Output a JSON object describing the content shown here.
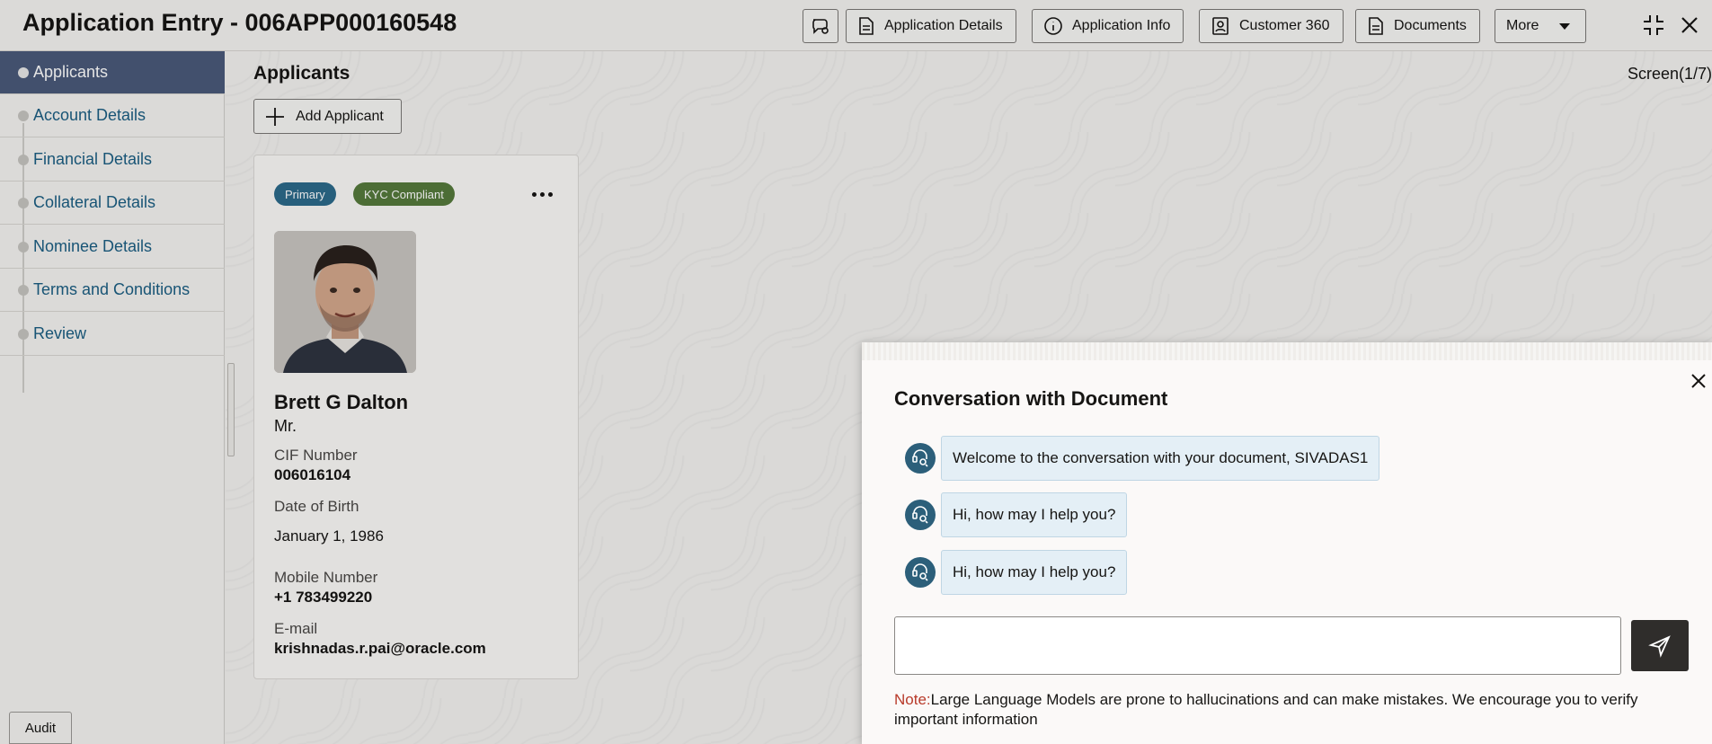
{
  "header": {
    "title": "Application Entry - 006APP000160548",
    "buttons": [
      {
        "label": "Application Details",
        "icon": "document-icon"
      },
      {
        "label": "Application Info",
        "icon": "info-icon"
      },
      {
        "label": "Customer 360",
        "icon": "customer-icon"
      },
      {
        "label": "Documents",
        "icon": "document-icon"
      },
      {
        "label": "More",
        "icon": "chevron-down-icon"
      }
    ],
    "chat_icon": "chat-icon",
    "collapse_icon": "collapse-icon",
    "close_icon": "close-icon"
  },
  "sidebar": {
    "items": [
      {
        "label": "Applicants",
        "active": true
      },
      {
        "label": "Account Details",
        "active": false
      },
      {
        "label": "Financial Details",
        "active": false
      },
      {
        "label": "Collateral Details",
        "active": false
      },
      {
        "label": "Nominee Details",
        "active": false
      },
      {
        "label": "Terms and Conditions",
        "active": false
      },
      {
        "label": "Review",
        "active": false
      }
    ],
    "audit_label": "Audit"
  },
  "main": {
    "title": "Applicants",
    "screen": "Screen(1/7)",
    "add_applicant_label": "Add Applicant"
  },
  "applicant": {
    "badges": {
      "primary": "Primary",
      "kyc": "KYC Compliant"
    },
    "name": "Brett G Dalton",
    "salutation": "Mr.",
    "cif_label": "CIF Number",
    "cif_value": "006016104",
    "dob_label": "Date of Birth",
    "dob_value": "January 1, 1986",
    "mobile_label": "Mobile Number",
    "mobile_value": "+1 783499220",
    "email_label": "E-mail",
    "email_value": "krishnadas.r.pai@oracle.com"
  },
  "chat": {
    "title": "Conversation with Document",
    "messages": [
      "Welcome to the conversation with your document, SIVADAS1",
      "Hi, how may I help you?",
      "Hi, how may I help you?"
    ],
    "input_value": "",
    "note_label": "Note:",
    "note_text": "Large Language Models are prone to hallucinations and can make mistakes. We encourage you to verify important information"
  },
  "colors": {
    "accent_blue": "#2c6a8b",
    "kyc_green": "#557a3c",
    "active_nav": "#4a5a7a",
    "link_blue": "#1b5e83",
    "note_red": "#b83a2a"
  }
}
